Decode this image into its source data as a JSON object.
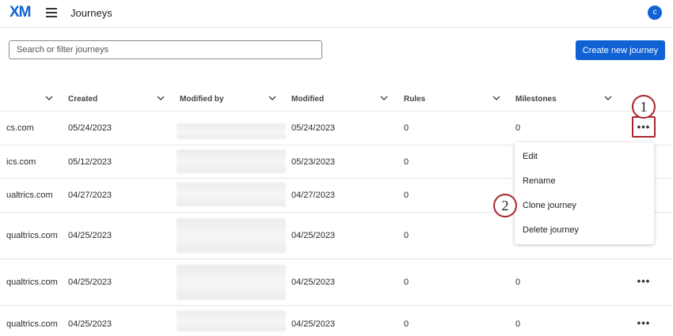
{
  "header": {
    "logo": "XM",
    "title": "Journeys",
    "avatar_initial": "c"
  },
  "search": {
    "placeholder": "Search or filter journeys"
  },
  "create_button_label": "Create new journey",
  "columns": [
    "Created",
    "Modified by",
    "Modified",
    "Rules",
    "Milestones"
  ],
  "rows": [
    {
      "name": "cs.com",
      "created": "05/24/2023",
      "modified": "05/24/2023",
      "rules": "0",
      "milestones": "0"
    },
    {
      "name": "ics.com",
      "created": "05/12/2023",
      "modified": "05/23/2023",
      "rules": "0",
      "milestones": ""
    },
    {
      "name": "ualtrics.com",
      "created": "04/27/2023",
      "modified": "04/27/2023",
      "rules": "0",
      "milestones": ""
    },
    {
      "name": "qualtrics.com",
      "created": "04/25/2023",
      "modified": "04/25/2023",
      "rules": "0",
      "milestones": ""
    },
    {
      "name": "qualtrics.com",
      "created": "04/25/2023",
      "modified": "04/25/2023",
      "rules": "0",
      "milestones": "0"
    },
    {
      "name": "qualtrics.com",
      "created": "04/25/2023",
      "modified": "04/25/2023",
      "rules": "0",
      "milestones": "0"
    }
  ],
  "row_menu_label": "•••",
  "context_menu": [
    "Edit",
    "Rename",
    "Clone journey",
    "Delete journey"
  ],
  "callouts": [
    "1",
    "2"
  ],
  "colors": {
    "brand": "#1062d4",
    "callout_border": "#a8262e"
  }
}
